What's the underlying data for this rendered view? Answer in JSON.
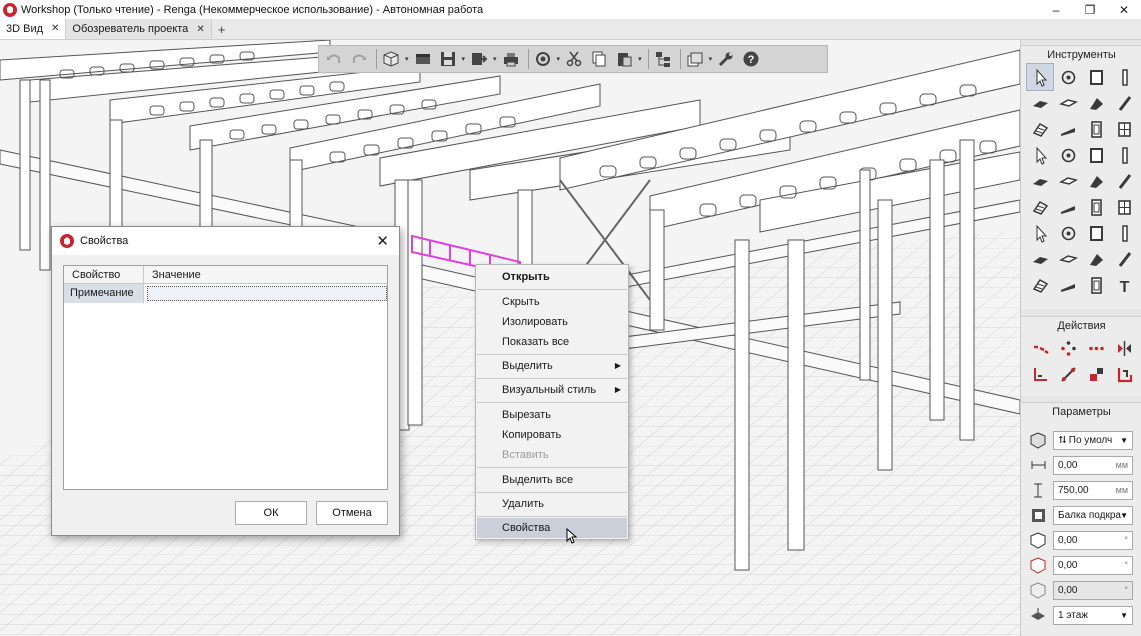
{
  "window": {
    "title": "Workshop (Только чтение) - Renga (Некоммерческое использование) - Автономная работа",
    "controls": {
      "minimize": "–",
      "restore": "❐",
      "close": "✕"
    }
  },
  "tabs": [
    {
      "label": "3D Вид",
      "close": "✕"
    },
    {
      "label": "Обозреватель проекта",
      "close": "✕"
    }
  ],
  "tab_add": "+",
  "toolbar": {
    "buttons": [
      "undo-icon",
      "redo-icon",
      "cube-view-icon",
      "floor-plan-icon",
      "save-icon",
      "export-icon",
      "print-icon",
      "orbit-icon",
      "cut-icon",
      "copy-icon",
      "paste-icon",
      "hierarchy-icon",
      "layers-icon",
      "wrench-icon",
      "help-icon"
    ],
    "dropdown_glyph": "▾"
  },
  "right_panel": {
    "tools_title": "Инструменты",
    "tools_icons": [
      "select-icon",
      "grid-axis-icon",
      "wall-icon",
      "column-icon",
      "slab-icon",
      "floor-icon",
      "roof-icon",
      "beam-icon",
      "stair-icon",
      "ramp-icon",
      "door-icon",
      "window-icon",
      "railing-icon",
      "line-icon",
      "element-icon",
      "opening-icon",
      "equipment-icon",
      "plumbing-icon",
      "mechanical-icon",
      "pipe-icon",
      "fitting-icon",
      "terminal-icon",
      "duct-icon",
      "accessory-icon",
      "valve-icon",
      "room-icon",
      "electric-icon",
      "panel-icon",
      "tank-icon",
      "light-icon",
      "outlet-icon",
      "cable-icon",
      "dimension-icon",
      "elevation-icon",
      "hatch-icon",
      "text-icon"
    ],
    "actions_title": "Действия",
    "actions_icons": [
      "move-icon",
      "rotate-icon",
      "array-icon",
      "mirror-icon",
      "align-icon",
      "trim-icon",
      "split-icon",
      "join-icon"
    ],
    "params_title": "Параметры",
    "params": {
      "placement_value": "⮁ По умолч",
      "offset_value": "0,00",
      "offset_unit": "мм",
      "height_value": "750,00",
      "height_unit": "мм",
      "style_value": "Балка подкра",
      "angle1_value": "0,00",
      "angle1_unit": "°",
      "angle2_value": "0,00",
      "angle2_unit": "°",
      "angle3_value": "0,00",
      "angle3_unit": "°",
      "level_value": "1 этаж",
      "combo_glyph": "▼"
    }
  },
  "dialog": {
    "title": "Свойства",
    "close": "✕",
    "col_property": "Свойство",
    "col_value": "Значение",
    "rows": [
      {
        "property": "Примечание",
        "value": ""
      }
    ],
    "ok": "ОК",
    "cancel": "Отмена"
  },
  "context_menu": {
    "items": [
      {
        "label": "Открыть",
        "style": "bold"
      },
      {
        "label": "Скрыть"
      },
      {
        "label": "Изолировать"
      },
      {
        "label": "Показать все"
      },
      {
        "label": "Выделить",
        "submenu": "▶"
      },
      {
        "label": "Визуальный стиль",
        "submenu": "▶"
      },
      {
        "label": "Вырезать"
      },
      {
        "label": "Копировать"
      },
      {
        "label": "Вставить",
        "disabled": true
      },
      {
        "label": "Выделить все"
      },
      {
        "label": "Удалить"
      },
      {
        "label": "Свойства",
        "hover": true
      }
    ]
  },
  "colors": {
    "accent_red": "#c8262f",
    "selection_magenta": "#e040e0",
    "menu_hover": "#c9d0d9"
  }
}
